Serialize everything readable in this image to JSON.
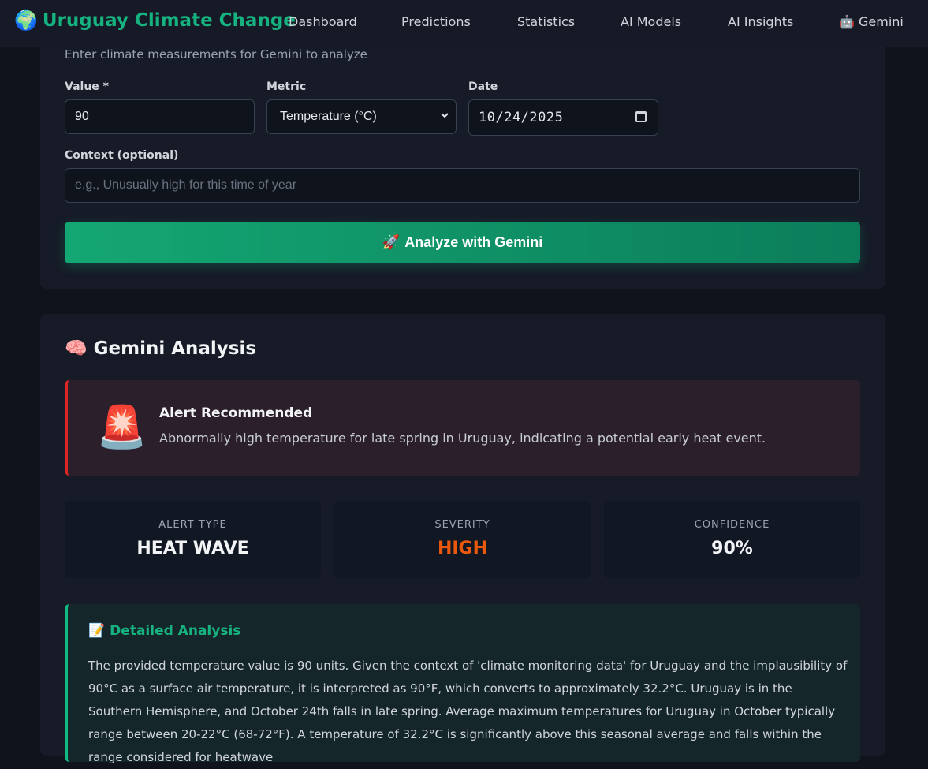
{
  "nav": {
    "brand_icon": "🌍",
    "brand": "Uruguay Climate Change",
    "links": [
      "Dashboard",
      "Predictions",
      "Statistics",
      "AI Models",
      "AI Insights",
      "Gemini"
    ],
    "gemini_icon": "🤖"
  },
  "form": {
    "subtitle": "Enter climate measurements for Gemini to analyze",
    "value_label": "Value *",
    "value": "90",
    "metric_label": "Metric",
    "metric_selected": "Temperature (°C)",
    "date_label": "Date",
    "date_value": "10/24/2025",
    "context_label": "Context (optional)",
    "context_placeholder": "e.g., Unusually high for this time of year",
    "analyze_icon": "🚀",
    "analyze_button": "Analyze with Gemini"
  },
  "analysis": {
    "icon": "🧠",
    "title": "Gemini Analysis",
    "alert": {
      "icon": "🚨",
      "title": "Alert Recommended",
      "description": "Abnormally high temperature for late spring in Uruguay, indicating a potential early heat event."
    },
    "stats": [
      {
        "label": "ALERT TYPE",
        "value": "HEAT WAVE",
        "color": "#f3f4f6"
      },
      {
        "label": "SEVERITY",
        "value": "HIGH",
        "color": "#ea580c"
      },
      {
        "label": "CONFIDENCE",
        "value": "90%",
        "color": "#f3f4f6"
      }
    ],
    "detail": {
      "icon": "📝",
      "title": "Detailed Analysis",
      "text": "The provided temperature value is 90 units. Given the context of 'climate monitoring data' for Uruguay and the implausibility of 90°C as a surface air temperature, it is interpreted as 90°F, which converts to approximately 32.2°C. Uruguay is in the Southern Hemisphere, and October 24th falls in late spring. Average maximum temperatures for Uruguay in October typically range between 20-22°C (68-72°F). A temperature of 32.2°C is significantly above this seasonal average and falls within the range considered for heatwave"
    }
  },
  "colors": {
    "accent": "#16b27f",
    "alert_border": "#dc2626",
    "severity_high": "#ea580c"
  }
}
